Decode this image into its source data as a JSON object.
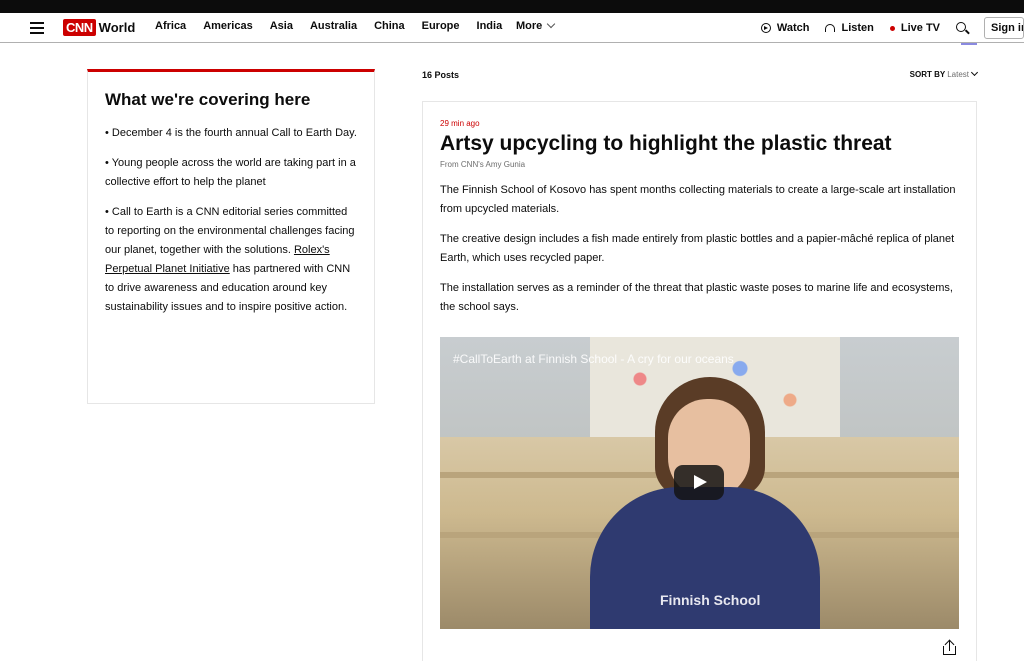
{
  "nav": {
    "logo": "CNN",
    "section": "World",
    "links": [
      "Africa",
      "Americas",
      "Asia",
      "Australia",
      "China",
      "Europe",
      "India"
    ],
    "more": "More",
    "watch": "Watch",
    "listen": "Listen",
    "live_tv": "Live TV",
    "sign_in": "Sign in"
  },
  "sidebar": {
    "title": "What we're covering here",
    "bullet1": "• December 4 is the fourth annual Call to Earth Day.",
    "bullet2": "• Young people across the world are taking part in a collective effort to help the planet",
    "bullet3_start": "• Call to Earth is a CNN editorial series committed to reporting on the environmental challenges facing our planet, together with the solutions. ",
    "bullet3_link": "Rolex's Perpetual Planet Initiative",
    "bullet3_end": " has partnered with CNN to drive awareness and education around key sustainability issues and to inspire positive action."
  },
  "feed": {
    "post_count": "16 Posts",
    "sort_label": "SORT BY",
    "sort_value": "Latest"
  },
  "post": {
    "time": "29 min ago",
    "headline": "Artsy upcycling to highlight the plastic threat",
    "byline": "From CNN's Amy Gunia",
    "p1": "The Finnish School of Kosovo has spent months collecting materials to create a large-scale art installation from upcycled materials.",
    "p2": "The creative design includes a fish made entirely from plastic bottles and a papier-mâché replica of planet Earth, which uses recycled paper.",
    "p3": "The installation serves as a reminder of the threat that plastic waste poses to marine life and ecosystems, the school says.",
    "video_title": "#CallToEarth at Finnish School - A cry for our oceans",
    "hoodie_text": "Finnish School"
  },
  "colors": {
    "brand_red": "#cc0000"
  }
}
